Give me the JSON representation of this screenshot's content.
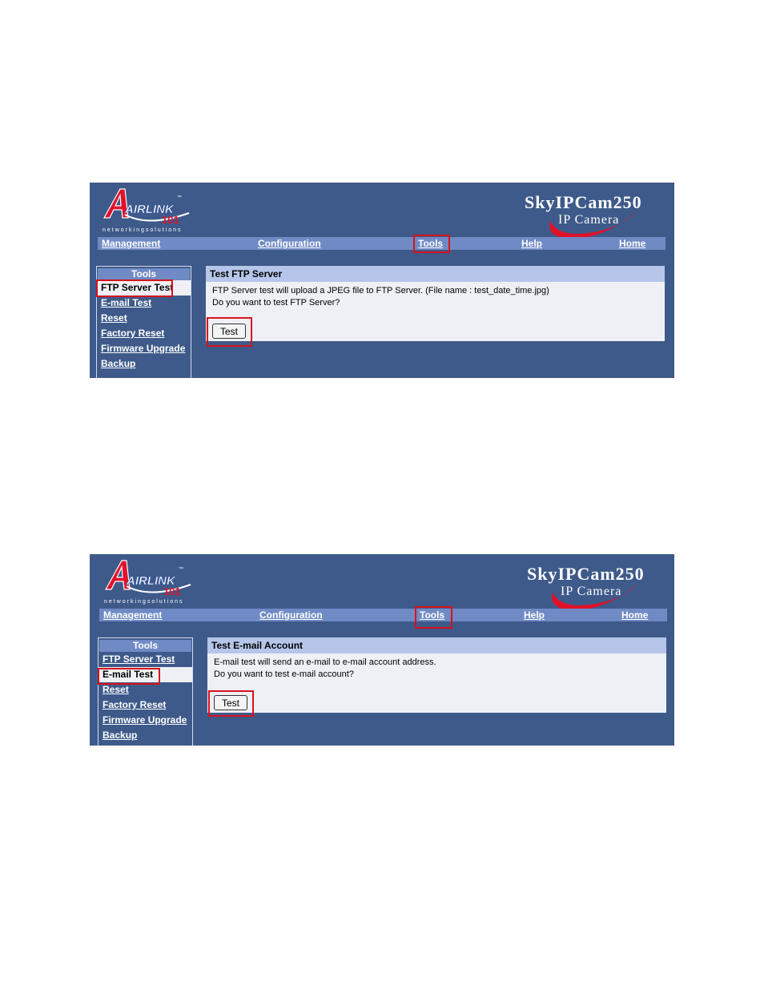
{
  "brand": {
    "logo_text": "AIRLINK",
    "logo_number": "101",
    "logo_tagline": "networkingsolutions",
    "product_title": "SkyIPCam250",
    "product_subtitle": "IP Camera"
  },
  "nav": {
    "management": "Management",
    "configuration": "Configuration",
    "tools": "Tools",
    "help": "Help",
    "home": "Home"
  },
  "sidebar": {
    "header": "Tools",
    "items": [
      "FTP Server Test",
      "E-mail Test",
      "Reset",
      "Factory Reset",
      "Firmware Upgrade",
      "Backup"
    ]
  },
  "screens": [
    {
      "panel_title": "Test FTP Server",
      "line1": "FTP Server test will upload a JPEG file to FTP Server. (File name : test_date_time.jpg)",
      "line2": "Do you want to test FTP Server?",
      "button": "Test"
    },
    {
      "panel_title": "Test E-mail Account",
      "line1": "E-mail test will send an e-mail to e-mail account address.",
      "line2": "Do you want to test e-mail account?",
      "button": "Test"
    }
  ],
  "colors": {
    "page_bg": "#3e5a8a",
    "navbar": "#6f8ac4",
    "panel_header": "#b5c6ea",
    "highlight_box": "#d8121b",
    "logo_red": "#e0122a"
  }
}
